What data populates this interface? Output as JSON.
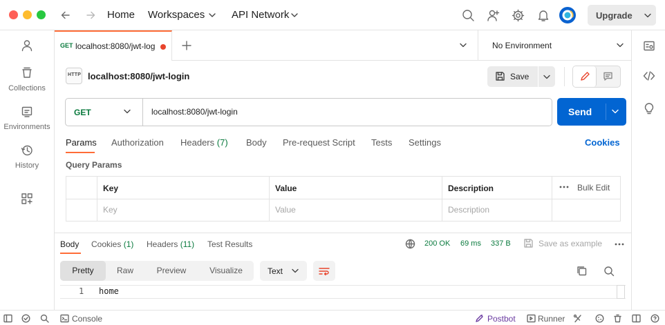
{
  "titlebar": {
    "home": "Home",
    "workspaces": "Workspaces",
    "api_network": "API Network",
    "upgrade": "Upgrade"
  },
  "sidebar": {
    "items": [
      {
        "label": ""
      },
      {
        "label": "Collections"
      },
      {
        "label": "Environments"
      },
      {
        "label": "History"
      }
    ]
  },
  "tab": {
    "method": "GET",
    "title": "localhost:8080/jwt-log",
    "environment": "No Environment"
  },
  "request": {
    "name": "localhost:8080/jwt-login",
    "http_badge": "HTTP",
    "save_label": "Save",
    "method": "GET",
    "url": "localhost:8080/jwt-login",
    "send_label": "Send"
  },
  "request_tabs": {
    "params": "Params",
    "authorization": "Authorization",
    "headers": "Headers",
    "headers_count": "(7)",
    "body": "Body",
    "prerequest": "Pre-request Script",
    "tests": "Tests",
    "settings": "Settings",
    "cookies": "Cookies"
  },
  "params": {
    "section_title": "Query Params",
    "col_key": "Key",
    "col_value": "Value",
    "col_description": "Description",
    "bulk_edit": "Bulk Edit",
    "ph_key": "Key",
    "ph_value": "Value",
    "ph_description": "Description"
  },
  "response": {
    "tab_body": "Body",
    "tab_cookies": "Cookies",
    "cookies_count": "(1)",
    "tab_headers": "Headers",
    "headers_count": "(11)",
    "tab_tests": "Test Results",
    "status": "200 OK",
    "time": "69 ms",
    "size": "337 B",
    "save_example": "Save as example",
    "views": [
      "Pretty",
      "Raw",
      "Preview",
      "Visualize"
    ],
    "format": "Text",
    "line_number": "1",
    "line_text": "home"
  },
  "statusbar": {
    "console": "Console",
    "postbot": "Postbot",
    "runner": "Runner"
  },
  "colors": {
    "accent_orange": "#ff6c37",
    "send_blue": "#0265d2",
    "get_green": "#0a7a3e",
    "postbot_purple": "#6a3aa0"
  }
}
